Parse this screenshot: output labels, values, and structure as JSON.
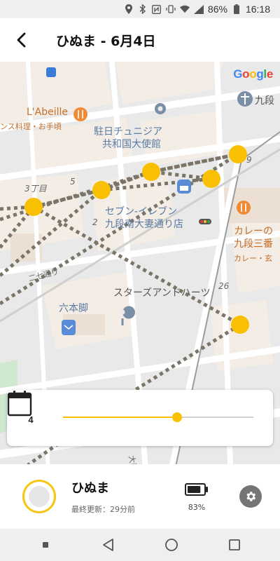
{
  "status_bar": {
    "battery": "86%",
    "time": "16:18",
    "icons": [
      "location-icon",
      "bluetooth-icon",
      "nfc-icon",
      "vibrate-icon",
      "wifi-icon",
      "signal-icon",
      "battery-icon"
    ]
  },
  "header": {
    "title": "ひぬま - 6月4日",
    "back_icon": "back-arrow-icon"
  },
  "map": {
    "logo": "Google",
    "labels": {
      "abeille": "L'Abeille",
      "abeille_sub": "ンス料理・お手頃",
      "embassy_line1": "駐日チュニジア",
      "embassy_line2": "共和国大使館",
      "chome3": "3丁目",
      "block5": "5",
      "block2": "2",
      "block9": "9",
      "block26": "26",
      "seven_line1": "セブン-イレブン",
      "seven_line2": "九段南大妻通り店",
      "curry_line1": "カレーの",
      "curry_line2": "九段三番",
      "curry_line3": "カレー・玄",
      "kudan": "九段",
      "nishichi": "二七通り",
      "stars": "スターズアンドハーツ",
      "rokuhonmaki": "六本脚",
      "otsuma": "大妻通り"
    }
  },
  "timeline": {
    "calendar_day": "4",
    "slider_value": 0.6
  },
  "device": {
    "name": "ひぬま",
    "last_updated": "最終更新：29分前",
    "battery": "83%",
    "battery_level": 0.83
  },
  "nav": {
    "icons": [
      "recent-dot-icon",
      "back-triangle-icon",
      "home-circle-icon",
      "overview-square-icon"
    ]
  },
  "colors": {
    "accent": "#F8C000",
    "track_dots": "#7a7566",
    "map_bg": "#E9E9E9",
    "road": "#FFFFFF",
    "block": "#F3EDE6"
  }
}
